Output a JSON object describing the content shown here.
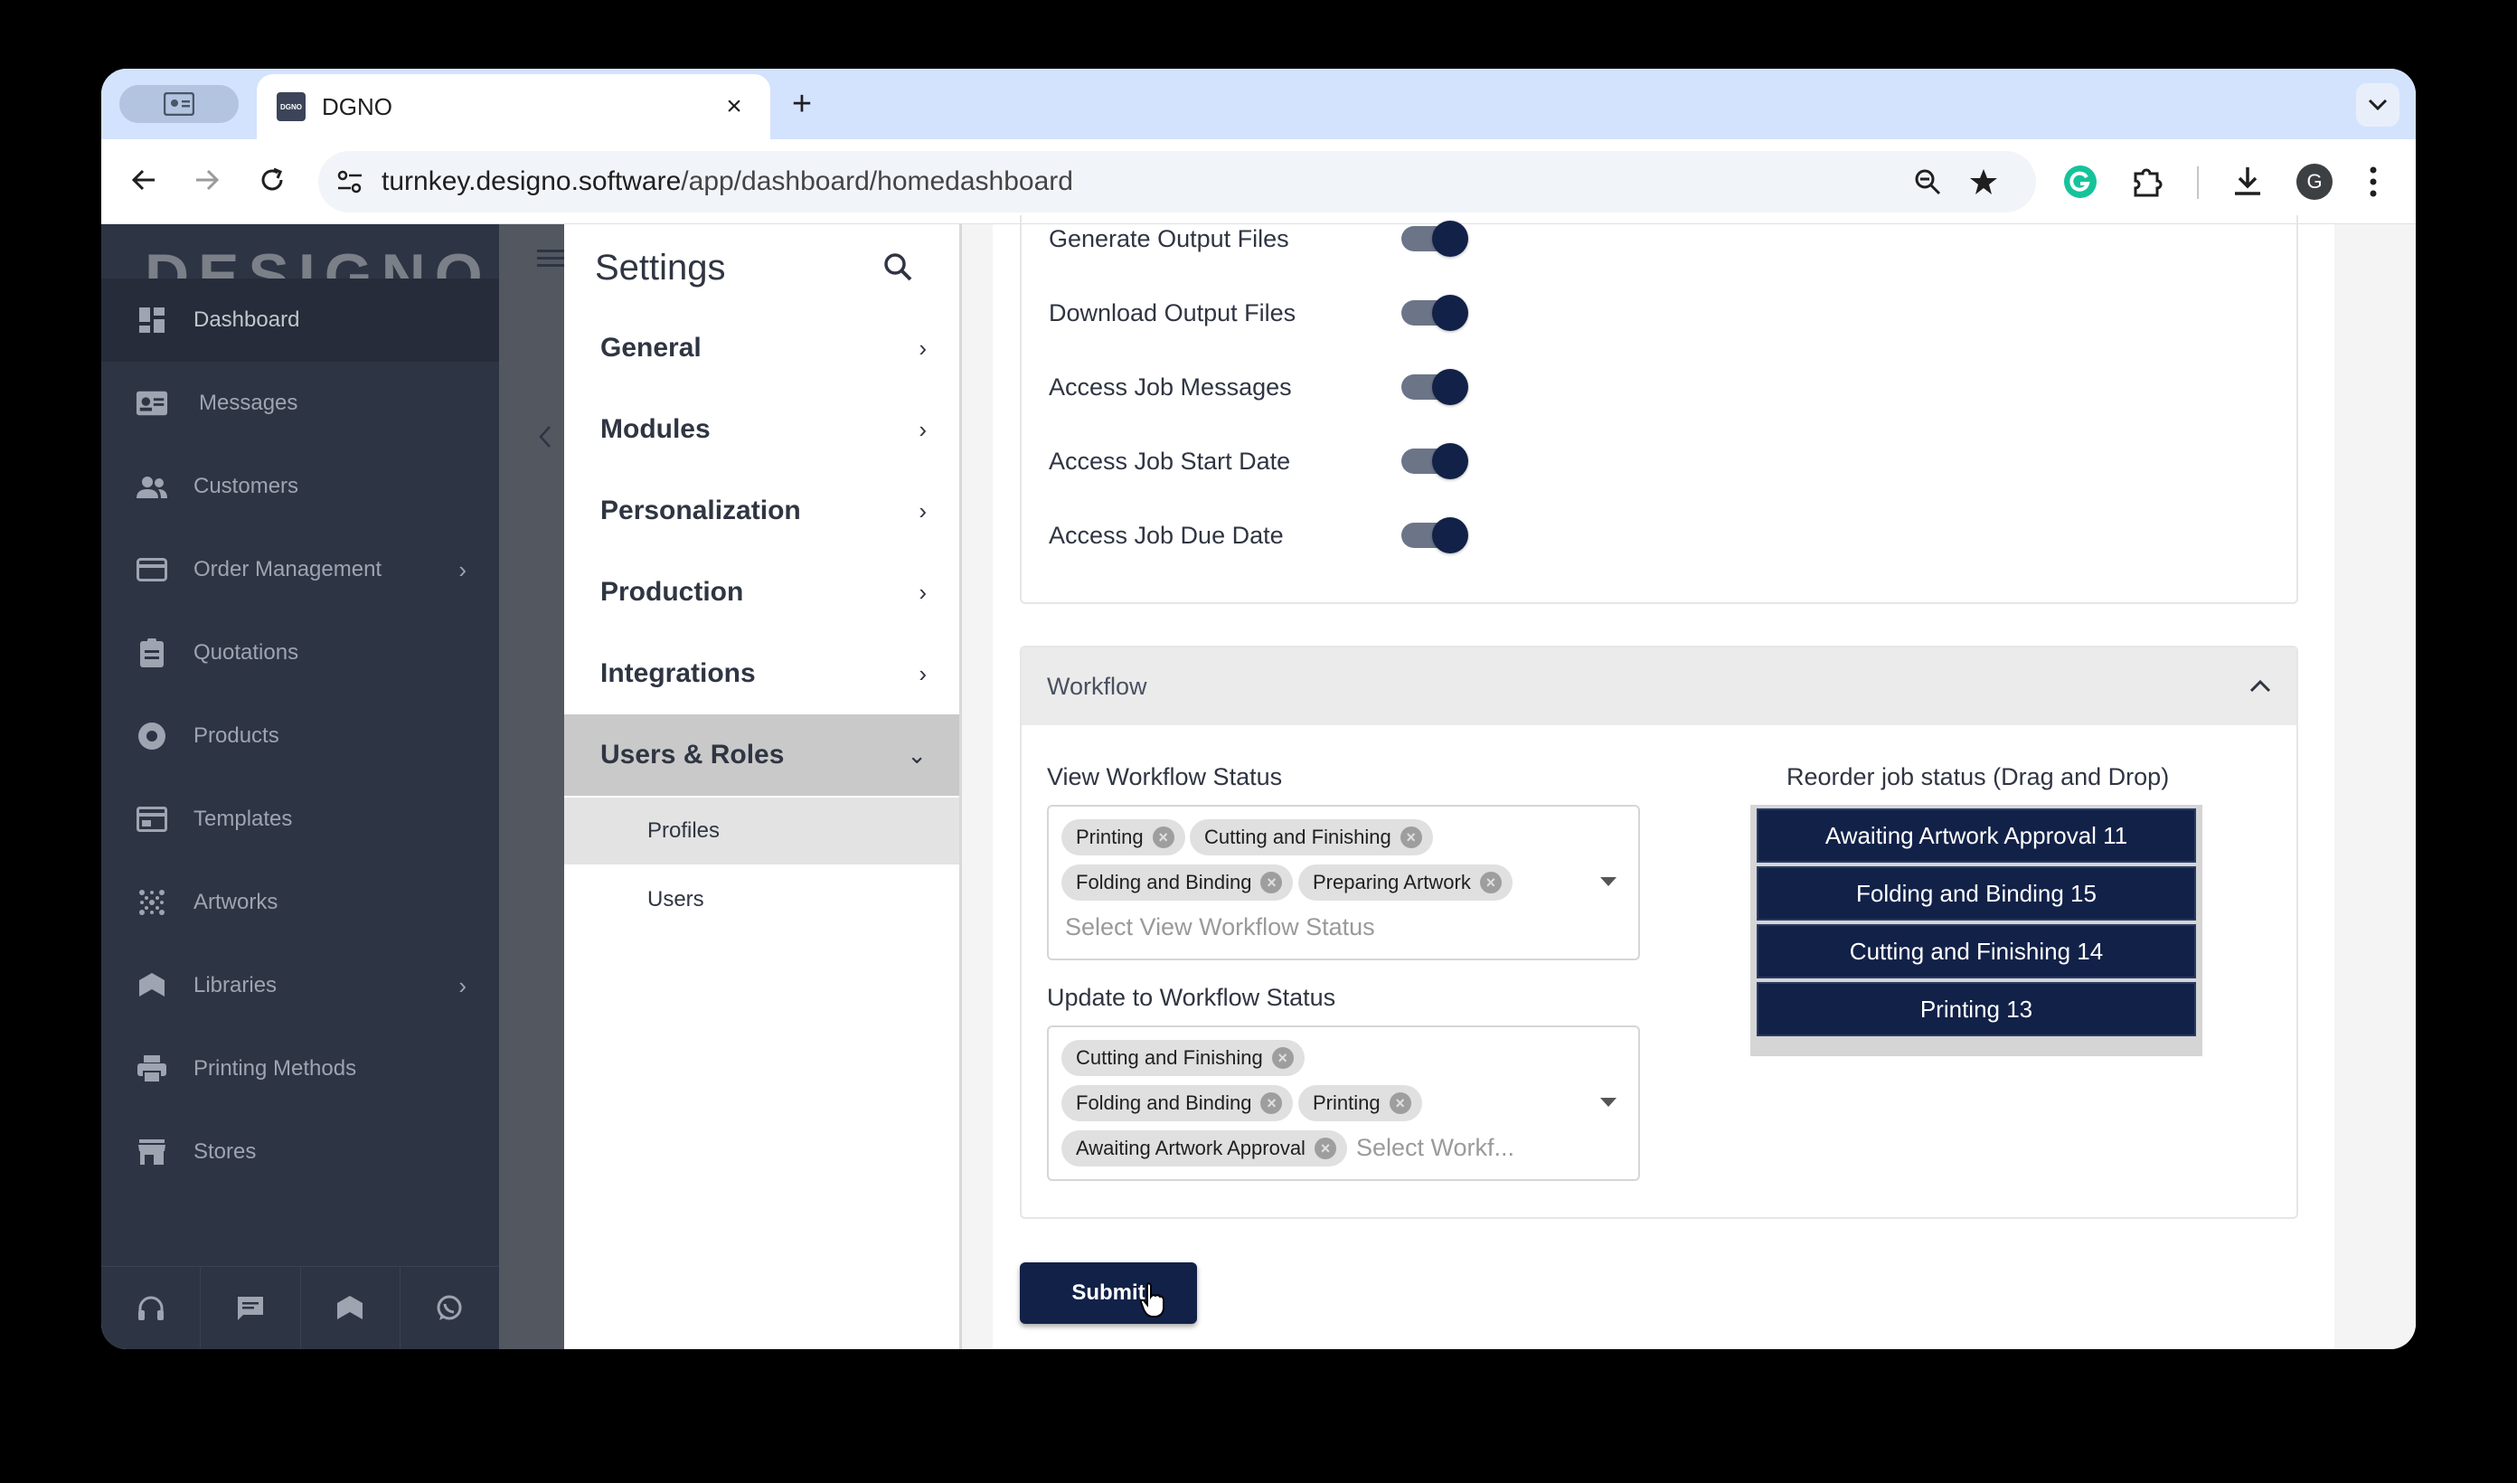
{
  "browser": {
    "tab_title": "DGNO",
    "favicon_text": "DGNO",
    "url_host": "turnkey.designo.software",
    "url_path": "/app/dashboard/homedashboard",
    "profile_initial": "G"
  },
  "sidebar": {
    "logo": "DESIGNO",
    "items": [
      {
        "label": "Dashboard",
        "icon": "dashboard-icon",
        "arrow": ""
      },
      {
        "label": "Messages",
        "icon": "messages-icon",
        "arrow": ""
      },
      {
        "label": "Customers",
        "icon": "customers-icon",
        "arrow": ""
      },
      {
        "label": "Order Management",
        "icon": "credit-card-icon",
        "arrow": "›"
      },
      {
        "label": "Quotations",
        "icon": "clipboard-icon",
        "arrow": ""
      },
      {
        "label": "Products",
        "icon": "products-icon",
        "arrow": ""
      },
      {
        "label": "Templates",
        "icon": "templates-icon",
        "arrow": ""
      },
      {
        "label": "Artworks",
        "icon": "artworks-icon",
        "arrow": ""
      },
      {
        "label": "Libraries",
        "icon": "libraries-icon",
        "arrow": "›"
      },
      {
        "label": "Printing Methods",
        "icon": "printer-icon",
        "arrow": ""
      },
      {
        "label": "Stores",
        "icon": "store-icon",
        "arrow": ""
      }
    ]
  },
  "settings": {
    "title": "Settings",
    "menu": [
      {
        "label": "General",
        "arrow": "›"
      },
      {
        "label": "Modules",
        "arrow": "›"
      },
      {
        "label": "Personalization",
        "arrow": "›"
      },
      {
        "label": "Production",
        "arrow": "›"
      },
      {
        "label": "Integrations",
        "arrow": "›"
      },
      {
        "label": "Users & Roles",
        "arrow": "⌄"
      }
    ],
    "submenu": [
      {
        "label": "Profiles"
      },
      {
        "label": "Users"
      }
    ]
  },
  "permissions": [
    {
      "label": "Generate Output Files",
      "enabled": true
    },
    {
      "label": "Download Output Files",
      "enabled": true
    },
    {
      "label": "Access Job Messages",
      "enabled": true
    },
    {
      "label": "Access Job Start Date",
      "enabled": true
    },
    {
      "label": "Access Job Due Date",
      "enabled": true
    }
  ],
  "workflow": {
    "title": "Workflow",
    "view_label": "View Workflow Status",
    "view_chips": [
      "Printing",
      "Cutting and Finishing",
      "Folding and Binding",
      "Preparing Artwork"
    ],
    "view_placeholder": "Select View Workflow Status",
    "update_label": "Update to Workflow Status",
    "update_chips": [
      "Cutting and Finishing",
      "Folding and Binding",
      "Printing",
      "Awaiting Artwork Approval"
    ],
    "update_placeholder": "Select Workf...",
    "reorder_label": "Reorder job status (Drag and Drop)",
    "reorder_items": [
      "Awaiting Artwork Approval 11",
      "Folding and Binding 15",
      "Cutting and Finishing 14",
      "Printing 13"
    ]
  },
  "submit_label": "Submit",
  "colors": {
    "accent": "#122148",
    "sidebar": "#2d3444"
  }
}
